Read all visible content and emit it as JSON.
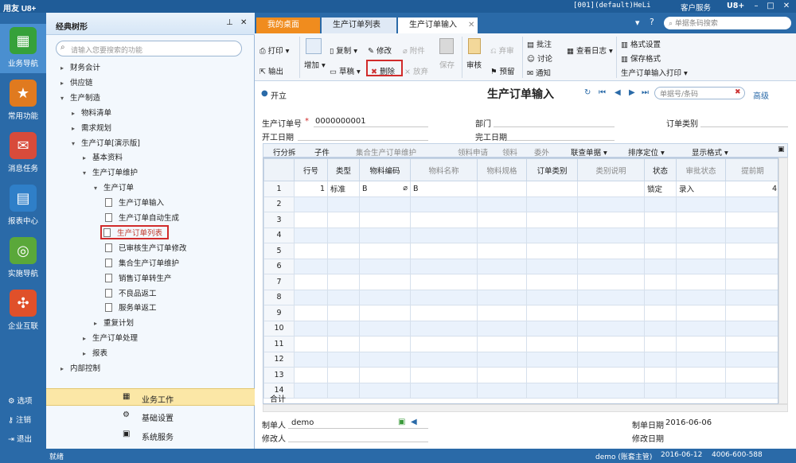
{
  "titlebar": {
    "logo": "用友 U8+",
    "account": "[001](default)HeLi",
    "service": "客户服务",
    "ufx": "U8+",
    "min": "–",
    "max": "□",
    "close": "✕"
  },
  "leftnav": {
    "items": [
      {
        "label": "业务导航",
        "icon": "business-nav-icon",
        "color": "#36a13a"
      },
      {
        "label": "常用功能",
        "icon": "star-icon",
        "color": "#e07a1f"
      },
      {
        "label": "消息任务",
        "icon": "message-icon",
        "color": "#d84b3b"
      },
      {
        "label": "报表中心",
        "icon": "report-icon",
        "color": "#2f7fc8"
      },
      {
        "label": "实施导航",
        "icon": "compass-icon",
        "color": "#5aa83a"
      },
      {
        "label": "企业互联",
        "icon": "connect-icon",
        "color": "#e0502a"
      }
    ],
    "bottom": [
      "选项",
      "注销",
      "退出"
    ]
  },
  "tree": {
    "title": "经典树形",
    "search_placeholder": "请输入您要搜索的功能",
    "rows": [
      {
        "label": "财务会计",
        "level": 0,
        "expanded": false
      },
      {
        "label": "供应链",
        "level": 0,
        "expanded": false
      },
      {
        "label": "生产制造",
        "level": 0,
        "expanded": true
      },
      {
        "label": "物料清单",
        "level": 1,
        "expanded": false
      },
      {
        "label": "需求规划",
        "level": 1,
        "expanded": false
      },
      {
        "label": "生产订单[演示版]",
        "level": 1,
        "expanded": true
      },
      {
        "label": "基本资料",
        "level": 2,
        "expanded": false
      },
      {
        "label": "生产订单维护",
        "level": 2,
        "expanded": true
      },
      {
        "label": "生产订单",
        "level": 3,
        "expanded": true
      },
      {
        "label": "生产订单输入",
        "level": 4,
        "doc": true
      },
      {
        "label": "生产订单自动生成",
        "level": 4,
        "doc": true
      },
      {
        "label": "生产订单列表",
        "level": 4,
        "doc": true,
        "selected": true
      },
      {
        "label": "已审核生产订单修改",
        "level": 4,
        "doc": true
      },
      {
        "label": "集合生产订单维护",
        "level": 4,
        "doc": true
      },
      {
        "label": "销售订单转生产",
        "level": 4,
        "doc": true
      },
      {
        "label": "不良品返工",
        "level": 4,
        "doc": true
      },
      {
        "label": "服务单返工",
        "level": 4,
        "doc": true
      },
      {
        "label": "重复计划",
        "level": 3,
        "expanded": false
      },
      {
        "label": "生产订单处理",
        "level": 2,
        "expanded": false
      },
      {
        "label": "报表",
        "level": 2,
        "expanded": false
      },
      {
        "label": "内部控制",
        "level": 0,
        "expanded": false
      }
    ],
    "bottom": [
      "业务工作",
      "基础设置",
      "系统服务"
    ]
  },
  "tabs": [
    "我的桌面",
    "生产订单列表",
    "生产订单输入"
  ],
  "toolbar": {
    "print": "打印",
    "output": "输出",
    "add": "增加",
    "copy": "复制",
    "draft": "草稿",
    "modify": "修改",
    "attach": "附件",
    "delete": "删除",
    "abandon": "放弃",
    "save": "保存",
    "audit": "审核",
    "discard": "弃审",
    "alert": "预留",
    "annot": "批注",
    "discuss": "讨论",
    "notify": "通知",
    "log": "查看日志",
    "format_set": "格式设置",
    "save_format": "保存格式",
    "print_label": "生产订单输入打印"
  },
  "form": {
    "open_label": "开立",
    "title": "生产订单输入",
    "search_placeholder": "单据号/条码",
    "advanced": "高级",
    "order_no_label": "生产订单号",
    "order_no": "0000000001",
    "dept_label": "部门",
    "type_label": "订单类别",
    "start_label": "开工日期",
    "end_label": "完工日期",
    "required_mark": "*"
  },
  "gridbar": {
    "items": [
      "行分拆",
      "子件",
      "集合生产订单维护",
      "领料申请",
      "领料",
      "委外",
      "联查单据",
      "排序定位",
      "显示格式"
    ]
  },
  "grid": {
    "headers": [
      "",
      "行号",
      "类型",
      "物料编码",
      "物料名称",
      "物料规格",
      "订单类别",
      "类别说明",
      "状态",
      "审批状态",
      "提前期"
    ],
    "row1": [
      "1",
      "1",
      "标准",
      "B",
      "B",
      "",
      "",
      "",
      "锁定",
      "录入",
      "4"
    ],
    "row_numbers": [
      "2",
      "3",
      "4",
      "5",
      "6",
      "7",
      "8",
      "9",
      "10",
      "11",
      "12",
      "13",
      "14"
    ],
    "total_label": "合计"
  },
  "footer": {
    "maker_label": "制单人",
    "maker": "demo",
    "modifier_label": "修改人",
    "make_date_label": "制单日期",
    "make_date": "2016-06-06",
    "modify_date_label": "修改日期"
  },
  "statusbar": {
    "left": "就绪",
    "user": "demo (账套主管)",
    "date": "2016-06-12",
    "phone": "4006-600-588"
  }
}
